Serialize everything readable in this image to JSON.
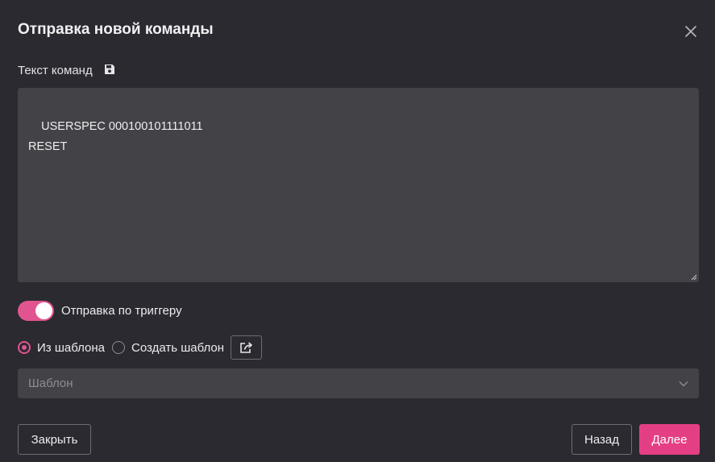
{
  "dialog": {
    "title": "Отправка новой команды",
    "close_icon": "close-icon"
  },
  "commands": {
    "label": "Текст команд",
    "save_icon": "save-icon",
    "text": "USERSPEC 000100101111011\nRESET"
  },
  "trigger": {
    "label": "Отправка по триггеру",
    "enabled": true
  },
  "template_mode": {
    "options": [
      {
        "label": "Из шаблона",
        "selected": true
      },
      {
        "label": "Создать шаблон",
        "selected": false
      }
    ],
    "share_icon": "share-icon"
  },
  "template_select": {
    "placeholder": "Шаблон",
    "icon": "chevron-down-icon"
  },
  "footer": {
    "close_label": "Закрыть",
    "back_label": "Назад",
    "next_label": "Далее"
  },
  "colors": {
    "background": "#2b2a30",
    "field": "#434247",
    "accent": "#e0548f",
    "primary_button": "#e43f84"
  }
}
